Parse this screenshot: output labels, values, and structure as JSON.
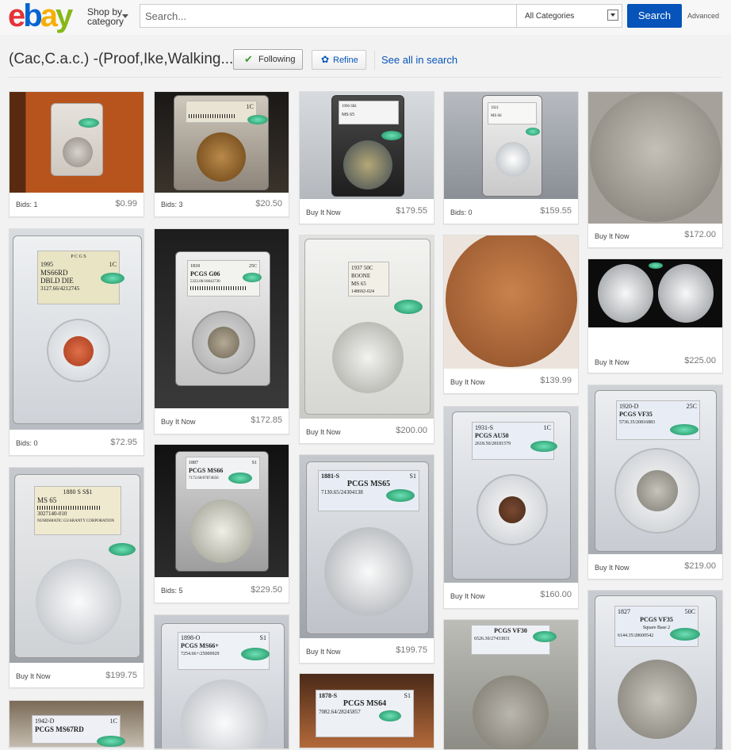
{
  "header": {
    "logo": [
      "e",
      "b",
      "a",
      "y"
    ],
    "logo_colors": [
      "#e53238",
      "#0064d2",
      "#f5af02",
      "#86b817"
    ],
    "shop_by": "Shop by",
    "category": "category",
    "search_placeholder": "Search...",
    "category_select": "All Categories",
    "search_button": "Search",
    "advanced": "Advanced"
  },
  "toolbar": {
    "title": "(Cac,C.a.c.) -(Proof,Ike,Walking...",
    "following": "Following",
    "refine": "Refine",
    "see_all": "See all in search"
  },
  "items": [
    {
      "status": "Bids: 1",
      "price": "$0.99"
    },
    {
      "status": "Bids: 3",
      "price": "$20.50"
    },
    {
      "status": "Buy It Now",
      "price": "$179.55"
    },
    {
      "status": "Bids: 0",
      "price": "$159.55"
    },
    {
      "status": "Buy It Now",
      "price": "$172.00"
    },
    {
      "status": "Bids: 0",
      "price": "$72.95"
    },
    {
      "status": "Buy It Now",
      "price": "$172.85"
    },
    {
      "status": "Buy It Now",
      "price": "$200.00"
    },
    {
      "status": "Buy It Now",
      "price": "$139.99"
    },
    {
      "status": "Buy It Now",
      "price": "$225.00"
    },
    {
      "status": "Buy It Now",
      "price": "$199.75"
    },
    {
      "status": "Bids: 5",
      "price": "$229.50"
    },
    {
      "status": "Buy It Now",
      "price": "$199.75"
    },
    {
      "status": "Buy It Now",
      "price": "$160.00"
    },
    {
      "status": "Buy It Now",
      "price": "$219.00"
    }
  ],
  "slab_labels": {
    "c1_2": [
      "1C"
    ],
    "c1_3": [
      "1996 S$1",
      "MS 65"
    ],
    "c1_4": [
      "1921",
      "MS 66"
    ],
    "c2_1": [
      "P C G S",
      "1995",
      "1C",
      "MS66RD",
      "DBLD DIE",
      "3127.66/4212745"
    ],
    "c2_2": [
      "1818",
      "25C",
      "PCGS G06",
      "5322.06/18642730"
    ],
    "c2_3": [
      "1937 50C",
      "BOONE",
      "MS 65",
      "148692-024"
    ],
    "c3_1": [
      "1880 S S$1",
      "MS 65",
      "3027140-010",
      "NUMISMATIC GUARANTY CORPORATION"
    ],
    "c3_2": [
      "1887",
      "S1",
      "PCGS MS66",
      "7172.66/07874656"
    ],
    "c3_3": [
      "1881-S",
      "S1",
      "PCGS MS65",
      "7130.65/24304138"
    ],
    "c3_4": [
      "1931-S",
      "1C",
      "PCGS AU50",
      "2618.50/28181579"
    ],
    "c3_5": [
      "1920-D",
      "25C",
      "PCGS VF35",
      "5736.35/20816883"
    ],
    "c4_1": [
      "1942-D",
      "1C",
      "PCGS MS67RD"
    ],
    "c4_2": [
      "1898-O",
      "S1",
      "PCGS MS66+",
      "7254.66+/25000929"
    ],
    "c4_3": [
      "1878-S",
      "S1",
      "PCGS MS64",
      "7082.64/28245857"
    ],
    "c4_4": [
      "PCGS VF30",
      "6526.30/27433831"
    ],
    "c4_5": [
      "1827",
      "50C",
      "PCGS VF35",
      "Square Base 2",
      "6144.35/28600542"
    ]
  }
}
